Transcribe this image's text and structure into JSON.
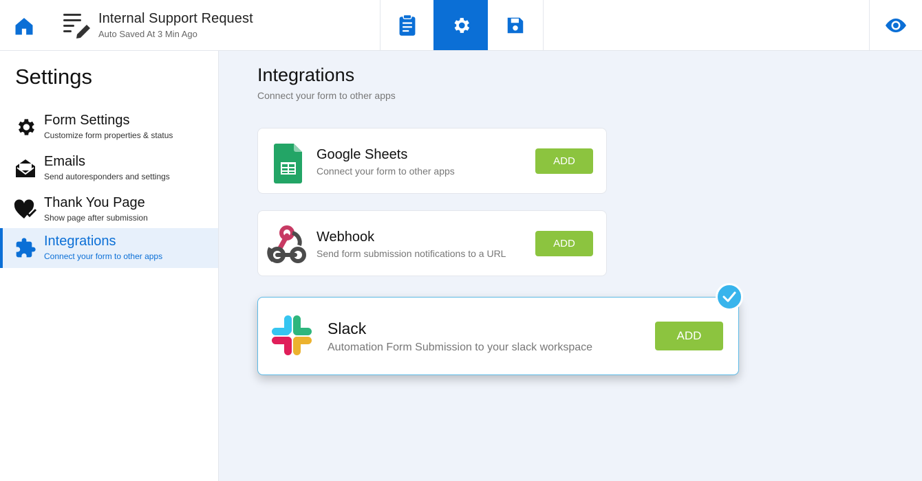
{
  "header": {
    "home_icon": "home-icon",
    "form_icon": "form-edit-icon",
    "form_title": "Internal Support Request",
    "autosave": "Auto Saved At 3 Min Ago",
    "tabs": [
      {
        "icon": "clipboard-icon",
        "active": false
      },
      {
        "icon": "gear-icon",
        "active": true
      },
      {
        "icon": "save-icon",
        "active": false
      }
    ],
    "preview_icon": "eye-icon",
    "accent": "#0b6fd6"
  },
  "sidebar": {
    "title": "Settings",
    "items": [
      {
        "label": "Form Settings",
        "desc": "Customize form properties & status",
        "icon": "gear-icon",
        "active": false
      },
      {
        "label": "Emails",
        "desc": "Send autoresponders and settings",
        "icon": "mail-icon",
        "active": false
      },
      {
        "label": "Thank You Page",
        "desc": "Show page after submission",
        "icon": "heart-check-icon",
        "active": false
      },
      {
        "label": "Integrations",
        "desc": "Connect your form to other apps",
        "icon": "puzzle-icon",
        "active": true
      }
    ]
  },
  "main": {
    "title": "Integrations",
    "subtitle": "Connect your form to other apps",
    "integrations": [
      {
        "name": "Google Sheets",
        "desc": "Connect your form to other apps",
        "button": "ADD",
        "icon": "google-sheets-icon"
      },
      {
        "name": "Webhook",
        "desc": "Send form submission notifications to a URL",
        "button": "ADD",
        "icon": "webhook-icon"
      },
      {
        "name": "Slack",
        "desc": "Automation Form Submission to your slack workspace",
        "button": "ADD",
        "icon": "slack-icon",
        "selected": true
      }
    ],
    "button_color": "#8cc43f",
    "selected_badge_color": "#38b4ec"
  }
}
